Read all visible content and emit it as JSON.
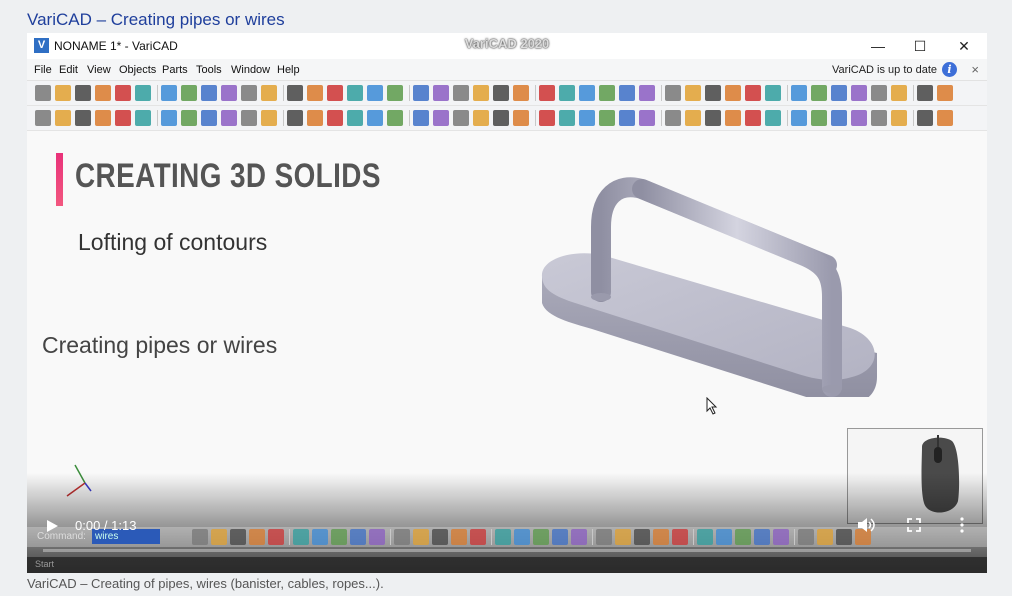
{
  "page": {
    "title": "VariCAD – Creating pipes or wires",
    "caption": "VariCAD – Creating of pipes, wires (banister, cables, ropes...)."
  },
  "window": {
    "title": "NONAME 1* - VariCAD",
    "video_brand": "VariCAD 2020",
    "app_icon": "V",
    "minimize": "—",
    "maximize": "☐",
    "close": "✕"
  },
  "menu": {
    "items": [
      "File",
      "Edit",
      "View",
      "Objects",
      "Parts",
      "Tools",
      "Window",
      "Help"
    ],
    "update_status": "VariCAD is up to date",
    "info_icon": "i",
    "close": "×"
  },
  "canvas": {
    "heading": "CREATING 3D SOLIDS",
    "subheading": "Lofting of contours",
    "topic": "Creating pipes or wires",
    "axes_label": "X Y Z"
  },
  "command": {
    "label": "Command:",
    "value": "wires"
  },
  "status": {
    "text": "Start"
  },
  "player": {
    "time": "0:00 / 1:13",
    "progress": 0.0
  },
  "colors": {
    "accent": "#e9327a",
    "link": "#1f3f9c",
    "model": "#b9b9c8"
  }
}
